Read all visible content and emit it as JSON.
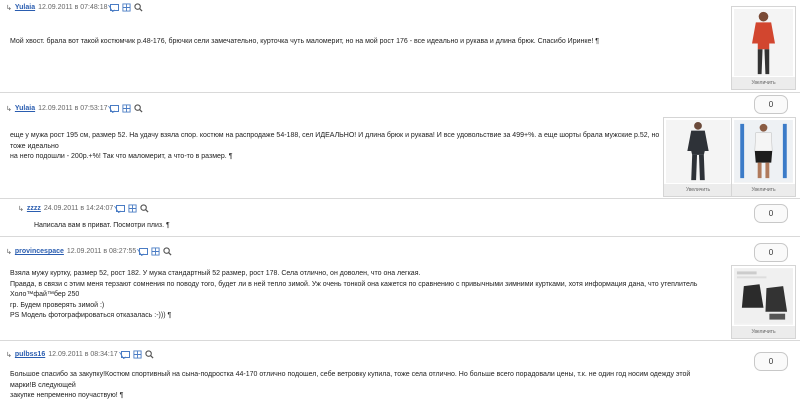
{
  "posts": [
    {
      "author": "Yulaia",
      "date": "12.09.2011 в 07:48:18",
      "lines": [
        "Мой хвост. брала вот такой костюмчик р.48-176, брючки сели замечательно, курточка чуть маломерит, но на мой рост 176 - все идеально и рукава и длина брюк. Спасибо Иринке! ¶"
      ],
      "photos": [
        {
          "caption": "Увеличить"
        }
      ]
    },
    {
      "author": "Yulaia",
      "date": "12.09.2011 в 07:53:17",
      "score": "0",
      "lines": [
        "еще у мужа рост 195 см, размер 52. На удачу взяла спор. костюм на распродаже 54-188, сел ИДЕАЛЬНО! И длина брюк и рукава! И все удовольствие за 499+%. а еще шорты брала мужские р.52, но тоже идеально",
        "на него подошли - 200р.+%! Так что маломерит, а что-то в размер. ¶"
      ],
      "photos": [
        {
          "caption": "Увеличить"
        },
        {
          "caption": "Увеличить"
        }
      ]
    },
    {
      "author": "zzzz",
      "date": "24.09.2011 в 14:24:07",
      "score": "0",
      "lines": [
        "Написала вам в приват. Посмотри плиз. ¶"
      ]
    },
    {
      "author": "provincespace",
      "date": "12.09.2011 в 08:27:55",
      "score": "0",
      "lines": [
        "Взяла мужу куртку, размер 52, рост 182. У мужа стандартный 52 размер, рост 178. Села отлично, он доволен, что она легкая.",
        "Правда, в связи с этим меня терзают сомнения по поводу того, будет ли в ней тепло зимой. Уж очень тонкой она кажется по сравнению с привычными зимними куртками, хотя информация дана, что утеплитель Холо™фай™бер 250",
        "гр. Будем проверять зимой :)",
        "PS Модель фотографироваться отказалась :-))) ¶"
      ],
      "photos": [
        {
          "caption": "Увеличить"
        }
      ]
    },
    {
      "author": "pulbss16",
      "date": "12.09.2011 в 08:34:17",
      "score": "0",
      "lines": [
        "Большое спасибо за закупку!Костюм спортивный на сына-подростка 44-170 отлично подошел, себе ветровку купила, тоже села отлично. Но больше всего порадовали цены, т.к. не один год носим одежду этой марки!В следующей",
        "закупке непременно поучаствую! ¶"
      ]
    }
  ]
}
